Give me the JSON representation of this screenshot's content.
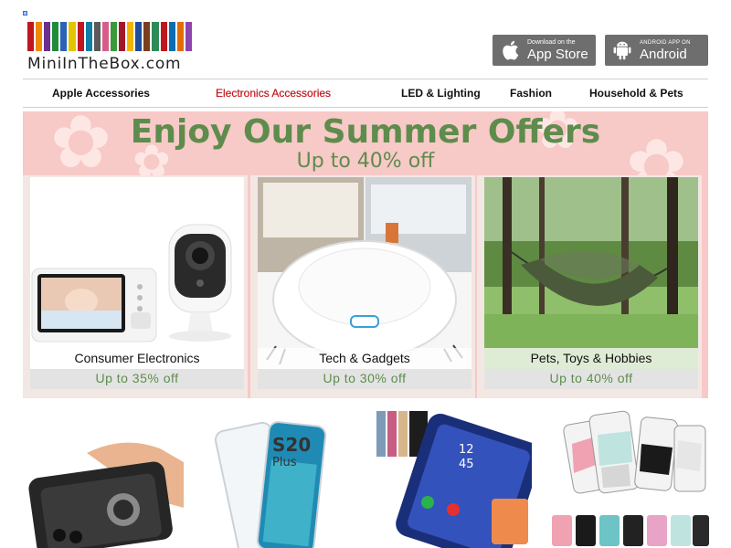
{
  "brand": {
    "name": "MiniInTheBox.com",
    "bar_colors": [
      "#c0161d",
      "#f08a00",
      "#6b2f8f",
      "#1f8c3a",
      "#2a63b8",
      "#e2c400",
      "#c0161d",
      "#0f7fa8",
      "#5a5a5a",
      "#d85c8a",
      "#3a9a3a",
      "#a3172a",
      "#f4b400",
      "#1e4e9c",
      "#7a3d1e",
      "#2e8b57",
      "#c0161d",
      "#0a6db4",
      "#e36c09",
      "#8e44ad"
    ]
  },
  "apps": {
    "appstore_small": "Download on the",
    "appstore_big": "App Store",
    "android_small": "ANDROID APP ON",
    "android_big": "Android"
  },
  "nav": {
    "items": [
      {
        "label": "Apple Accessories"
      },
      {
        "label": "Electronics Accessories"
      },
      {
        "label": "LED & Lighting"
      },
      {
        "label": "Fashion"
      },
      {
        "label": "Household & Pets"
      }
    ],
    "active_index": 1,
    "active_color": "#c0161d"
  },
  "banner": {
    "title": "Enjoy Our Summer Offers",
    "subtitle": "Up to 40% off",
    "accent_color": "#5e8c4c",
    "background": "#f7c9c7",
    "cards": [
      {
        "title": "Consumer Electronics",
        "offer": "Up to 35% off"
      },
      {
        "title": "Tech & Gadgets",
        "offer": "Up to 30% off"
      },
      {
        "title": "Pets, Toys & Hobbies",
        "offer": "Up to 40% off"
      }
    ]
  },
  "products": {
    "items": [
      {
        "icon": "rugged-phone-case-image"
      },
      {
        "icon": "clear-galaxy-case-image",
        "label": "S20 Plus"
      },
      {
        "icon": "mirror-flip-case-image",
        "clock": "12 45"
      },
      {
        "icon": "marble-phone-cases-image"
      }
    ]
  }
}
